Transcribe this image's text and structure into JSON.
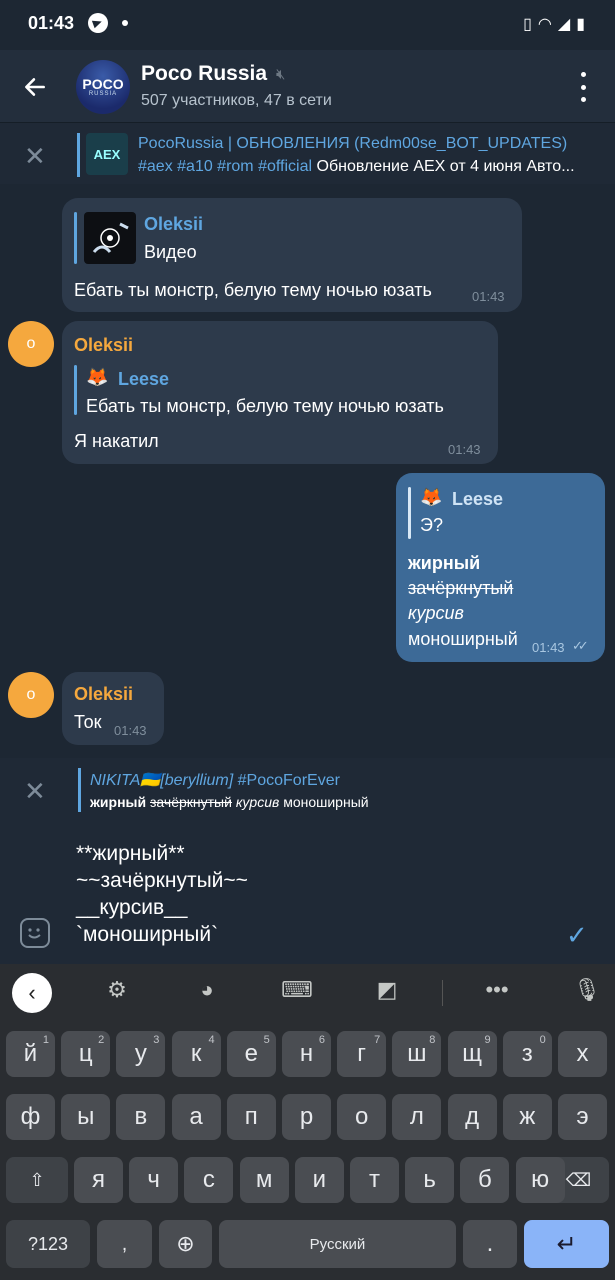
{
  "status": {
    "time": "01:43"
  },
  "header": {
    "title": "Poco Russia",
    "avatar_line1": "POCO",
    "avatar_line2": "RUSSIA",
    "subtitle": "507 участников, 47 в сети"
  },
  "pinned": {
    "title": "PocoRussia | ОБНОВЛЕНИЯ (Redm00se_BOT_UPDATES)",
    "tags": "#aex #a10 #rom #official",
    "text": " Обновление AEX от 4 июня Авто...",
    "thumb_label": "AEX"
  },
  "messages": [
    {
      "reply_name": "Oleksii",
      "reply_text": "Видео",
      "text": "Ебать ты монстр, белую тему ночью юзать",
      "time": "01:43"
    },
    {
      "avatar": "o",
      "sender": "Oleksii",
      "reply_name": "Leese",
      "reply_emoji": "🦊",
      "reply_text": "Ебать ты монстр, белую тему ночью юзать",
      "text": "Я накатил",
      "time": "01:43"
    },
    {
      "reply_name": "Leese",
      "reply_emoji": "🦊",
      "reply_text": "Э?",
      "line_bold": "жирный",
      "line_strike": "зачёркнутый",
      "line_italic": "курсив",
      "line_mono": "моноширный",
      "time": "01:43",
      "ticks": "✓✓"
    },
    {
      "avatar": "o",
      "sender": "Oleksii",
      "text": "Ток",
      "time": "01:43"
    }
  ],
  "compose": {
    "reply_name": "NIKITA🇺🇦[beryllium]",
    "reply_tag": " #PocoForEver",
    "preview_bold": "жирный",
    "preview_strike": "зачёркнутый",
    "preview_italic": "курсив",
    "preview_mono": "моноширный",
    "text": "**жирный**\n~~зачёркнутый~~\n__курсив__\n`моноширный`"
  },
  "keyboard": {
    "row1": [
      {
        "k": "й",
        "n": "1"
      },
      {
        "k": "ц",
        "n": "2"
      },
      {
        "k": "у",
        "n": "3"
      },
      {
        "k": "к",
        "n": "4"
      },
      {
        "k": "е",
        "n": "5"
      },
      {
        "k": "н",
        "n": "6"
      },
      {
        "k": "г",
        "n": "7"
      },
      {
        "k": "ш",
        "n": "8"
      },
      {
        "k": "щ",
        "n": "9"
      },
      {
        "k": "з",
        "n": "0"
      },
      {
        "k": "х",
        "n": ""
      }
    ],
    "row2": [
      "ф",
      "ы",
      "в",
      "а",
      "п",
      "р",
      "о",
      "л",
      "д",
      "ж",
      "э"
    ],
    "row3": [
      "я",
      "ч",
      "с",
      "м",
      "и",
      "т",
      "ь",
      "б",
      "ю"
    ],
    "symbols_label": "?123",
    "comma": ",",
    "space_label": "Русский",
    "period": "."
  }
}
